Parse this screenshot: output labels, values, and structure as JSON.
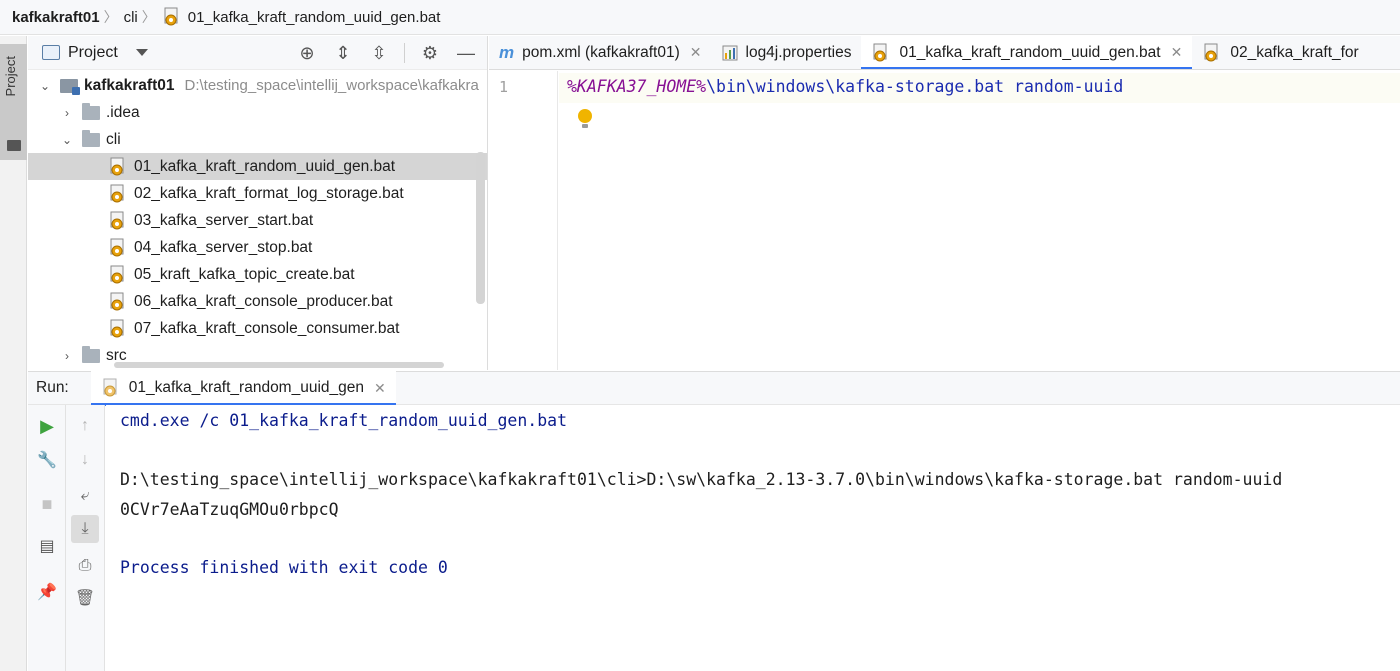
{
  "breadcrumb": {
    "items": [
      "kafkakraft01",
      "cli",
      "01_kafka_kraft_random_uuid_gen.bat"
    ]
  },
  "left_strip": {
    "project_tab": "Project"
  },
  "project_pane": {
    "title": "Project",
    "tree": {
      "root": {
        "name": "kafkakraft01",
        "path": "D:\\testing_space\\intellij_workspace\\kafkakra"
      },
      "idea": ".idea",
      "cli": "cli",
      "files": [
        "01_kafka_kraft_random_uuid_gen.bat",
        "02_kafka_kraft_format_log_storage.bat",
        "03_kafka_server_start.bat",
        "04_kafka_server_stop.bat",
        "05_kraft_kafka_topic_create.bat",
        "06_kafka_kraft_console_producer.bat",
        "07_kafka_kraft_console_consumer.bat"
      ],
      "src": "src"
    }
  },
  "editor": {
    "tabs": [
      {
        "label": "pom.xml (kafkakraft01)",
        "icon": "maven-icon"
      },
      {
        "label": "log4j.properties",
        "icon": "properties-icon"
      },
      {
        "label": "01_kafka_kraft_random_uuid_gen.bat",
        "icon": "bat-file-icon",
        "active": true
      },
      {
        "label": "02_kafka_kraft_for",
        "icon": "bat-file-icon"
      }
    ],
    "line_number": "1",
    "code": {
      "var": "%KAFKA37_HOME%",
      "rest": "\\bin\\windows\\kafka-storage.bat random-uuid"
    }
  },
  "run": {
    "label": "Run:",
    "tab_label": "01_kafka_kraft_random_uuid_gen",
    "console": [
      "cmd.exe /c 01_kafka_kraft_random_uuid_gen.bat",
      "D:\\testing_space\\intellij_workspace\\kafkakraft01\\cli>D:\\sw\\kafka_2.13-3.7.0\\bin\\windows\\kafka-storage.bat random-uuid",
      "0CVr7eAaTzuqGMOu0rbpcQ",
      "Process finished with exit code 0"
    ]
  },
  "colors": {
    "accent": "#3574f0",
    "console_blue": "#0b1c8c",
    "code_blue": "#1b2cb0",
    "code_var": "#871094"
  }
}
